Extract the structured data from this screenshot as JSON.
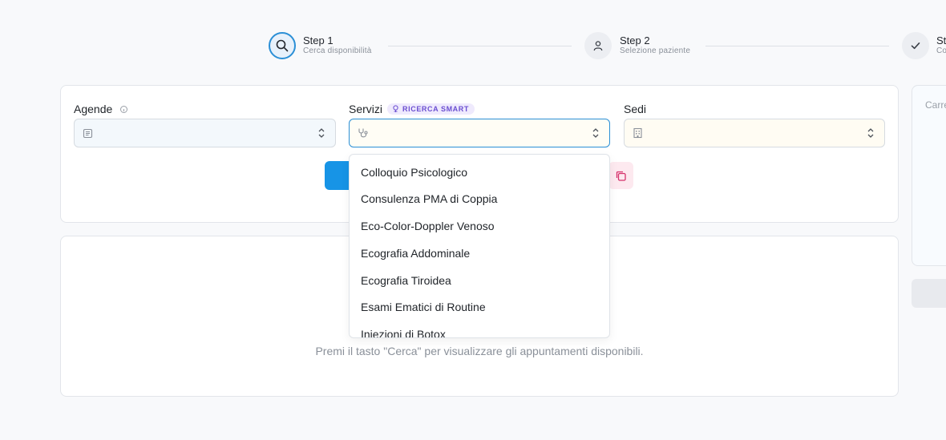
{
  "stepper": {
    "steps": [
      {
        "title": "Step 1",
        "subtitle": "Cerca disponibilità",
        "icon": "search-icon",
        "state": "active"
      },
      {
        "title": "Step 2",
        "subtitle": "Selezione paziente",
        "icon": "user-icon",
        "state": "pending"
      },
      {
        "title": "St",
        "subtitle": "Co",
        "icon": "check-icon",
        "state": "pending"
      }
    ]
  },
  "search": {
    "agende_label": "Agende",
    "servizi_label": "Servizi",
    "smart_badge": "RICERCA SMART",
    "sedi_label": "Sedi",
    "agende_value": "",
    "servizi_value": "",
    "sedi_value": ""
  },
  "dropdown": {
    "options": [
      "Colloquio Psicologico",
      "Consulenza PMA di Coppia",
      "Eco-Color-Doppler Venoso",
      "Ecografia Addominale",
      "Ecografia Tiroidea",
      "Esami Ematici di Routine",
      "Iniezioni di Botox"
    ]
  },
  "results": {
    "empty_message": "Premi il tasto \"Cerca\" per visualizzare gli appuntamenti disponibili."
  },
  "cart": {
    "label": "Carre"
  },
  "colors": {
    "accent": "#1794e6",
    "badge": "#6b4fd1",
    "copy_button_bg": "#fde9ef",
    "copy_icon": "#d6336c"
  }
}
